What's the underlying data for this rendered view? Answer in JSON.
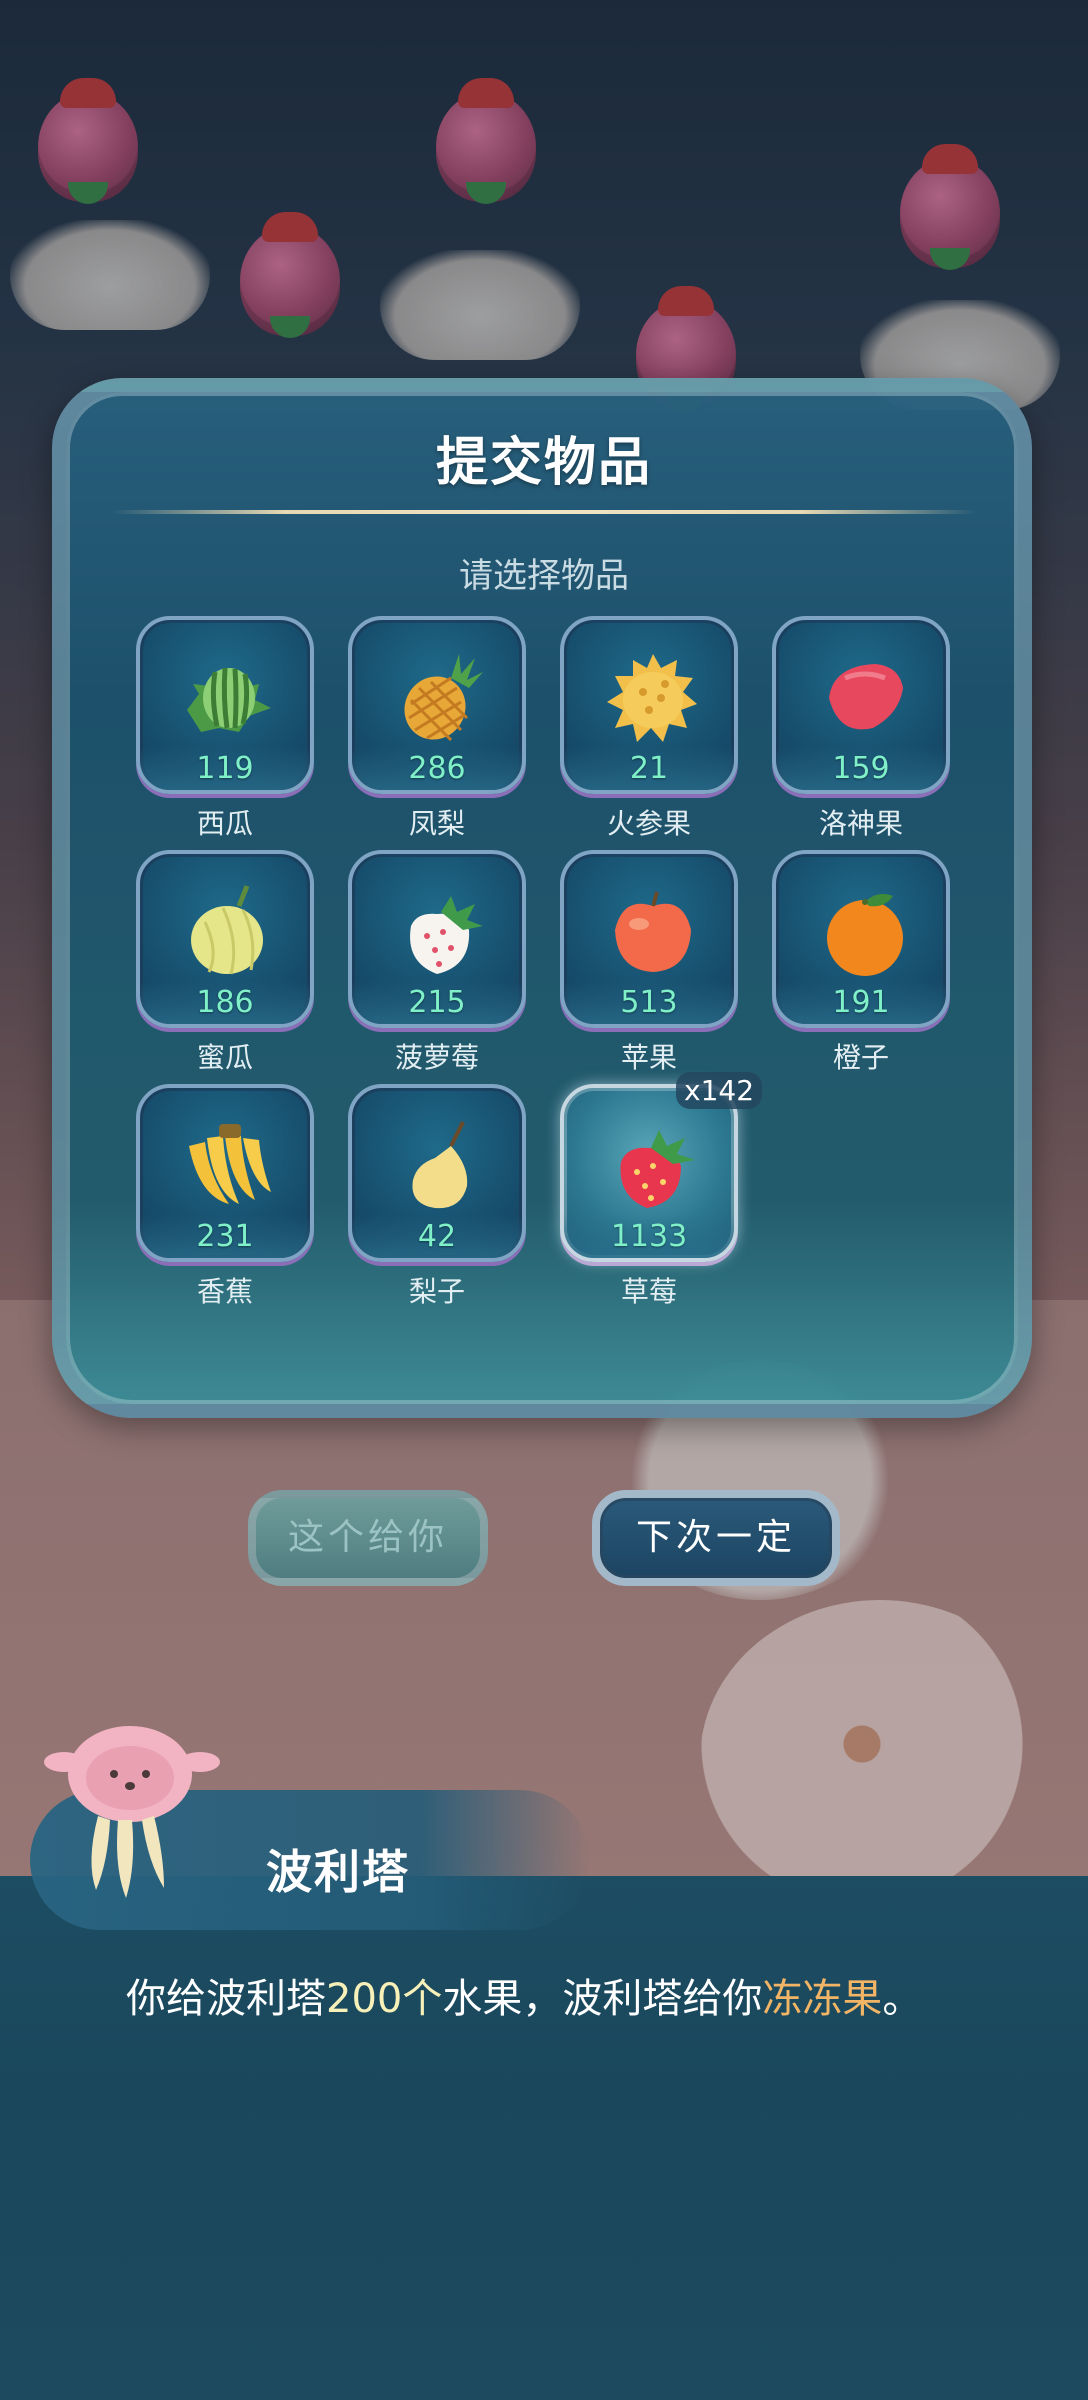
{
  "dialog": {
    "title": "提交物品",
    "subtitle": "请选择物品"
  },
  "items": [
    {
      "name": "西瓜",
      "count": "119",
      "icon": "watermelon-icon"
    },
    {
      "name": "凤梨",
      "count": "286",
      "icon": "pineapple-icon"
    },
    {
      "name": "火参果",
      "count": "21",
      "icon": "horned-melon-icon"
    },
    {
      "name": "洛神果",
      "count": "159",
      "icon": "roselle-icon"
    },
    {
      "name": "蜜瓜",
      "count": "186",
      "icon": "honeydew-icon"
    },
    {
      "name": "菠萝莓",
      "count": "215",
      "icon": "pineberry-icon"
    },
    {
      "name": "苹果",
      "count": "513",
      "icon": "apple-icon"
    },
    {
      "name": "橙子",
      "count": "191",
      "icon": "orange-icon"
    },
    {
      "name": "香蕉",
      "count": "231",
      "icon": "banana-icon"
    },
    {
      "name": "梨子",
      "count": "42",
      "icon": "pear-icon"
    },
    {
      "name": "草莓",
      "count": "1133",
      "icon": "strawberry-icon",
      "selected_qty": "x142"
    }
  ],
  "buttons": {
    "give": "这个给你",
    "next_time": "下次一定"
  },
  "dialogue": {
    "speaker": "波利塔",
    "text_part1": "你给波利塔",
    "text_amount": "200个",
    "text_part2": "水果，波利塔给你",
    "text_reward": "冻冻果",
    "text_end": "。"
  },
  "colors": {
    "count_text": "#7ff0c8",
    "reward_highlight": "#f2b566",
    "amount_highlight": "#f7f0b8",
    "panel_bg": "#1c526c"
  }
}
